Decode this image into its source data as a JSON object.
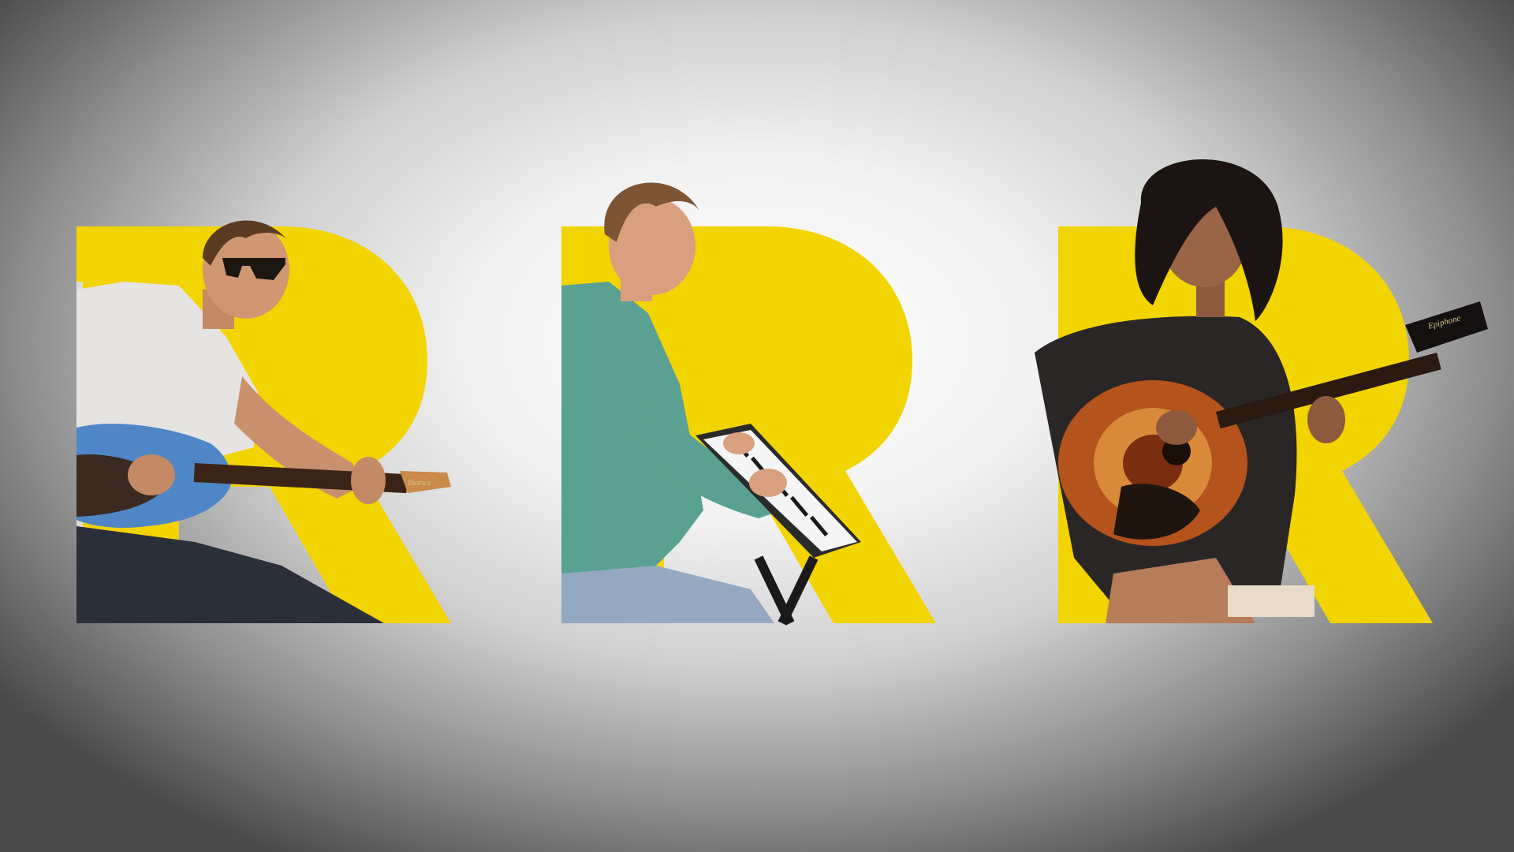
{
  "scene": {
    "background_center": "#ffffff",
    "background_edge": "#3a3a3a",
    "accent_yellow": "#f2d400",
    "letter_shape": "R-letter-icon"
  },
  "panels": [
    {
      "id": "guitarist",
      "subject": "man-with-electric-guitar",
      "instrument": "electric-guitar-icon",
      "headstock_logo": "Ibanez",
      "guitar_color": "#4f86c6"
    },
    {
      "id": "pianist",
      "subject": "man-at-digital-piano",
      "instrument": "piano-keyboard-icon",
      "sweater_color": "#5aa193"
    },
    {
      "id": "acoustic",
      "subject": "woman-with-acoustic-guitar",
      "instrument": "acoustic-guitar-icon",
      "headstock_logo": "Epiphone",
      "guitar_color": "#b5531c"
    }
  ]
}
